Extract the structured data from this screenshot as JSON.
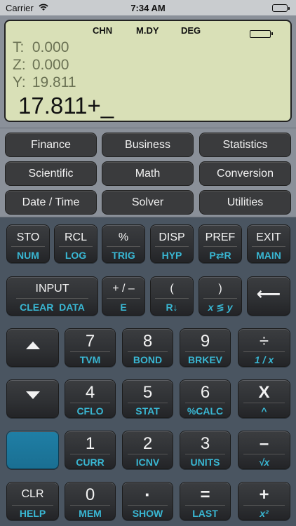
{
  "status_bar": {
    "carrier": "Carrier",
    "time": "7:34 AM"
  },
  "display": {
    "modes": [
      "CHN",
      "M.DY",
      "DEG"
    ],
    "stack": [
      {
        "label": "T:",
        "value": "0.000"
      },
      {
        "label": "Z:",
        "value": "0.000"
      },
      {
        "label": "Y:",
        "value": "19.811"
      }
    ],
    "entry": "17.811+_"
  },
  "menu": [
    "Finance",
    "Business",
    "Statistics",
    "Scientific",
    "Math",
    "Conversion",
    "Date / Time",
    "Solver",
    "Utilities"
  ],
  "keys": {
    "row1": [
      {
        "main": "STO",
        "sub": "NUM"
      },
      {
        "main": "RCL",
        "sub": "LOG"
      },
      {
        "main": "%",
        "sub": "TRIG"
      },
      {
        "main": "DISP",
        "sub": "HYP"
      },
      {
        "main": "PREF",
        "sub": "P⇄R"
      },
      {
        "main": "EXIT",
        "sub": "MAIN"
      }
    ],
    "row2": [
      {
        "main": "INPUT",
        "sub": "CLEAR  DATA"
      },
      {
        "main": "+ / –",
        "sub": "E"
      },
      {
        "main": "(",
        "sub": "R↓"
      },
      {
        "main": ")",
        "sub": "x ≶ y"
      },
      {
        "main": "⟵",
        "sub": ""
      }
    ],
    "row3": [
      {
        "main": "",
        "sub": "",
        "icon": "up-arrow-icon"
      },
      {
        "main": "7",
        "sub": "TVM"
      },
      {
        "main": "8",
        "sub": "BOND"
      },
      {
        "main": "9",
        "sub": "BRKEV"
      },
      {
        "main": "÷",
        "sub": "1 / x"
      }
    ],
    "row4": [
      {
        "main": "",
        "sub": "",
        "icon": "down-arrow-icon"
      },
      {
        "main": "4",
        "sub": "CFLO"
      },
      {
        "main": "5",
        "sub": "STAT"
      },
      {
        "main": "6",
        "sub": "%CALC"
      },
      {
        "main": "X",
        "sub": "^"
      }
    ],
    "row5": [
      {
        "main": "",
        "sub": ""
      },
      {
        "main": "1",
        "sub": "CURR"
      },
      {
        "main": "2",
        "sub": "ICNV"
      },
      {
        "main": "3",
        "sub": "UNITS"
      },
      {
        "main": "–",
        "sub": "√x"
      }
    ],
    "row6": [
      {
        "main": "CLR",
        "sub": "HELP"
      },
      {
        "main": "0",
        "sub": "MEM"
      },
      {
        "main": "·",
        "sub": "SHOW"
      },
      {
        "main": "=",
        "sub": "LAST"
      },
      {
        "main": "+",
        "sub": "x²"
      }
    ]
  },
  "colors": {
    "lcd": "#d9e0b7",
    "accent_blue": "#39b7d3",
    "key": "#2e3033"
  }
}
